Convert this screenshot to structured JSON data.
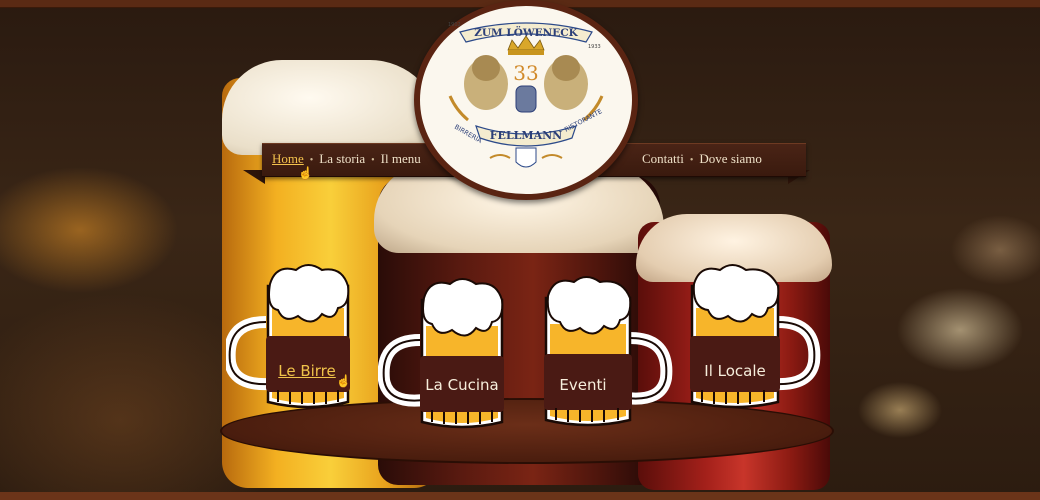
{
  "nav": {
    "left": [
      {
        "label": "Home",
        "active": true
      },
      {
        "label": "La storia",
        "active": false
      },
      {
        "label": "Il menu",
        "active": false
      }
    ],
    "right": [
      {
        "label": "Contatti",
        "active": false
      },
      {
        "label": "Dove siamo",
        "active": false
      }
    ]
  },
  "logo": {
    "top_text": "ZUM LÖWENECK",
    "number": "33",
    "left_text": "BIRRERIA",
    "right_text": "RISTORANTE",
    "name": "FELLMANN",
    "year_left": "1902",
    "year_right": "1933"
  },
  "mugs": [
    {
      "label": "Le Birre",
      "active": true
    },
    {
      "label": "La Cucina",
      "active": false
    },
    {
      "label": "Eventi",
      "active": false
    },
    {
      "label": "Il Locale",
      "active": false
    }
  ],
  "colors": {
    "frame": "#5a2a14",
    "ribbon": "#3a1a0e",
    "active_link": "#f2c14d",
    "beer": "#f3b021",
    "mug_band": "#4a1a14"
  },
  "icons": [
    "hand-cursor-icon",
    "lion-crest-icon"
  ]
}
